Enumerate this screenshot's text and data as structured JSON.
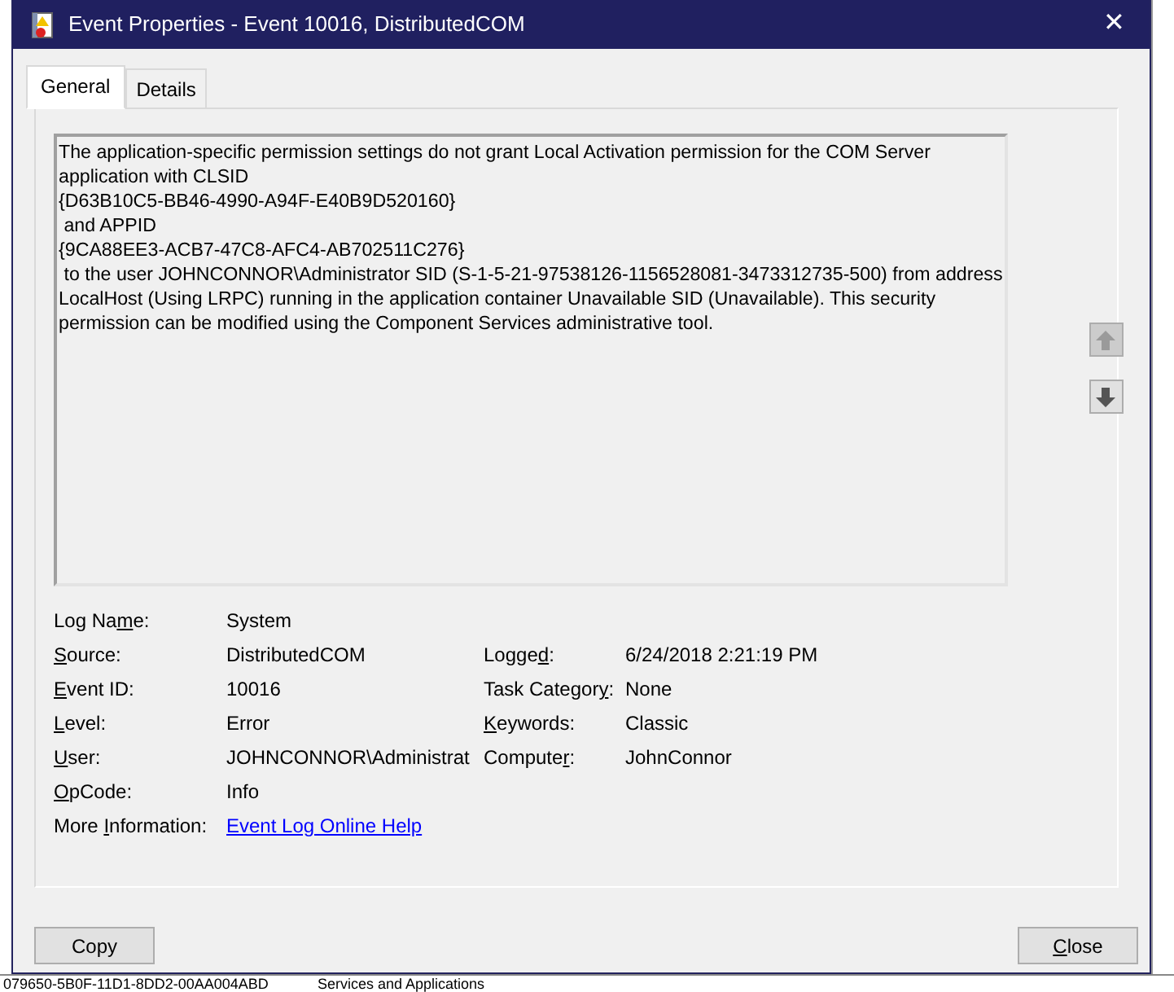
{
  "window": {
    "title": "Event Properties - Event 10016, DistributedCOM",
    "close_glyph": "✕"
  },
  "tabs": [
    {
      "label": "General",
      "selected": true
    },
    {
      "label": "Details",
      "selected": false
    }
  ],
  "message": "The application-specific permission settings do not grant Local Activation permission for the COM Server\napplication with CLSID\n{D63B10C5-BB46-4990-A94F-E40B9D520160}\n and APPID\n{9CA88EE3-ACB7-47C8-AFC4-AB702511C276}\n to the user JOHNCONNOR\\Administrator SID (S-1-5-21-97538126-1156528081-3473312735-500) from address\nLocalHost (Using LRPC) running in the application container Unavailable SID (Unavailable). This security\npermission can be modified using the Component Services administrative tool.",
  "nav_buttons": [
    {
      "kind": "up",
      "disabled": true
    },
    {
      "kind": "down",
      "disabled": false
    }
  ],
  "fields": [
    {
      "label": {
        "before": "Log Na",
        "key": "m",
        "after": "e:"
      },
      "value": "System"
    },
    {
      "label": {
        "key": "S",
        "after": "ource:"
      },
      "value": "DistributedCOM",
      "label2": {
        "before": "Logge",
        "key": "d",
        "after": ":"
      },
      "value2": "6/24/2018 2:21:19 PM"
    },
    {
      "label": {
        "key": "E",
        "after": "vent ID:"
      },
      "value": "10016",
      "label2": {
        "before": "Task Categor",
        "key": "y",
        "after": ":"
      },
      "value2": "None"
    },
    {
      "label": {
        "key": "L",
        "after": "evel:"
      },
      "value": "Error",
      "label2": {
        "key": "K",
        "after": "eywords:"
      },
      "value2": "Classic"
    },
    {
      "label": {
        "key": "U",
        "after": "ser:"
      },
      "value": "JOHNCONNOR\\Administrat",
      "label2": {
        "before": "Compute",
        "key": "r",
        "after": ":"
      },
      "value2": "JohnConnor"
    },
    {
      "label": {
        "key": "O",
        "after": "pCode:"
      },
      "value": "Info"
    },
    {
      "label": {
        "before": "More ",
        "key": "I",
        "after": "nformation:"
      },
      "link": "Event Log Online Help"
    }
  ],
  "buttons": [
    {
      "label": {
        "before": "Copy"
      }
    },
    {
      "label": {
        "key": "C",
        "after": "lose"
      }
    }
  ],
  "background": {
    "texts": [
      "079650-5B0F-11D1-8DD2-00AA004ABD",
      "Services and Applications"
    ]
  }
}
